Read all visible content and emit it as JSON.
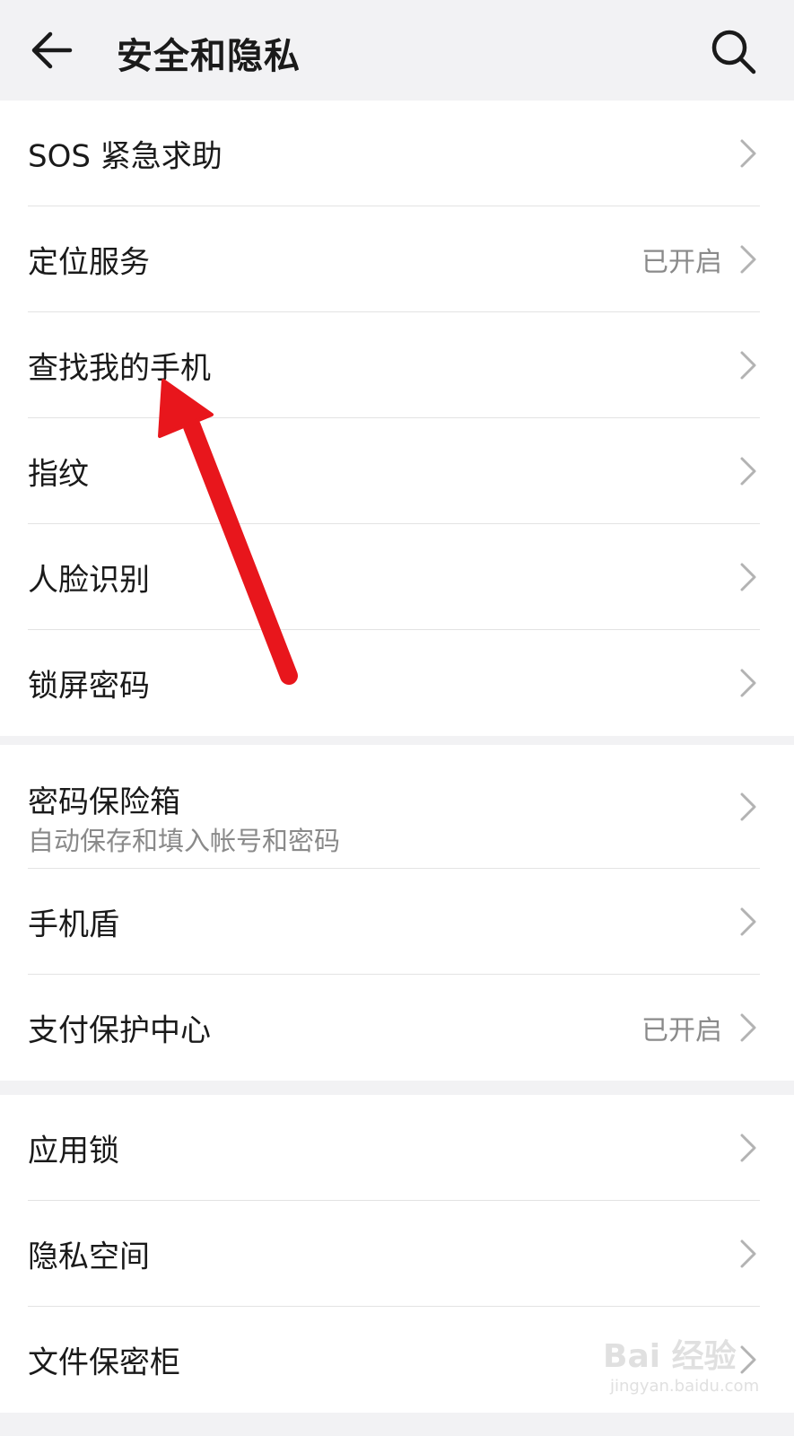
{
  "header": {
    "title": "安全和隐私",
    "back_icon": "back-arrow-icon",
    "search_icon": "search-icon"
  },
  "groups": [
    {
      "items": [
        {
          "label": "SOS 紧急求助",
          "status": ""
        },
        {
          "label": "定位服务",
          "status": "已开启"
        },
        {
          "label": "查找我的手机",
          "status": ""
        },
        {
          "label": "指纹",
          "status": ""
        },
        {
          "label": "人脸识别",
          "status": ""
        },
        {
          "label": "锁屏密码",
          "status": ""
        }
      ]
    },
    {
      "items": [
        {
          "label": "密码保险箱",
          "subtitle": "自动保存和填入帐号和密码",
          "status": ""
        },
        {
          "label": "手机盾",
          "status": ""
        },
        {
          "label": "支付保护中心",
          "status": "已开启"
        }
      ]
    },
    {
      "items": [
        {
          "label": "应用锁",
          "status": ""
        },
        {
          "label": "隐私空间",
          "status": ""
        },
        {
          "label": "文件保密柜",
          "status": ""
        }
      ]
    }
  ],
  "annotation": {
    "color": "#e8161c",
    "points_to": "查找我的手机"
  },
  "watermark": {
    "logo": "Bai 经验",
    "url": "jingyan.baidu.com"
  },
  "colors": {
    "background": "#f2f2f4",
    "card": "#ffffff",
    "secondary_text": "#8a8a8a"
  }
}
